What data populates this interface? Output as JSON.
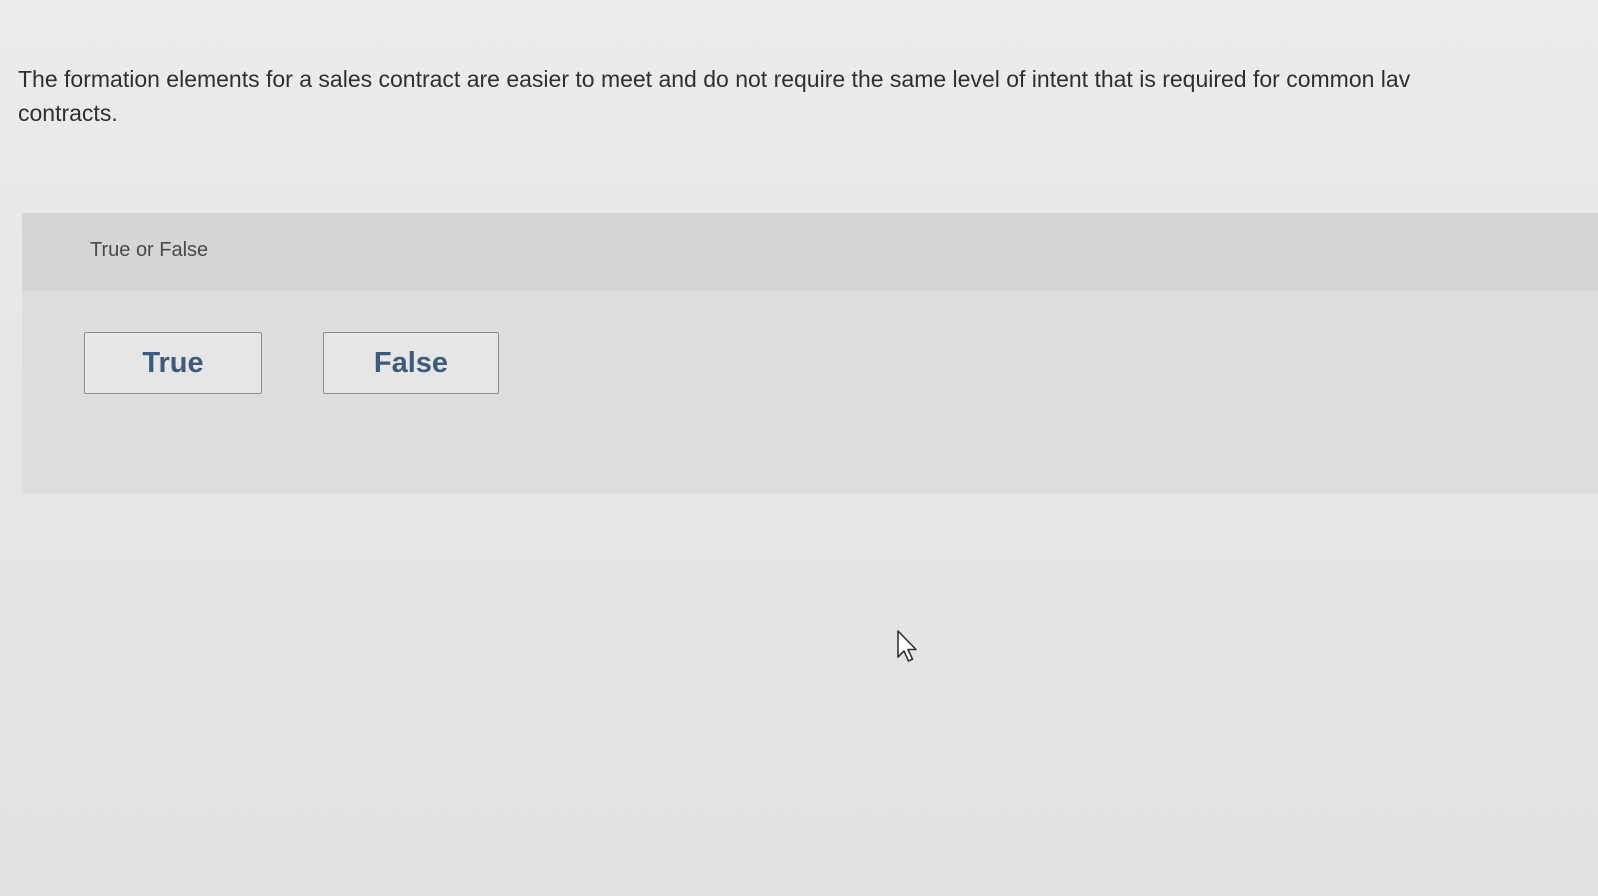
{
  "question": {
    "line1": "The formation elements for a sales contract are easier to meet and do not require the same level of intent that is required for common lav",
    "line2": "contracts."
  },
  "panel": {
    "type_label": "True or False"
  },
  "choices": [
    {
      "label": "True"
    },
    {
      "label": "False"
    }
  ],
  "colors": {
    "button_text": "#3e5a7a",
    "panel_bg": "#dddddd",
    "header_bg": "#d5d5d5"
  },
  "icons": {
    "cursor": "mouse-pointer-icon"
  }
}
